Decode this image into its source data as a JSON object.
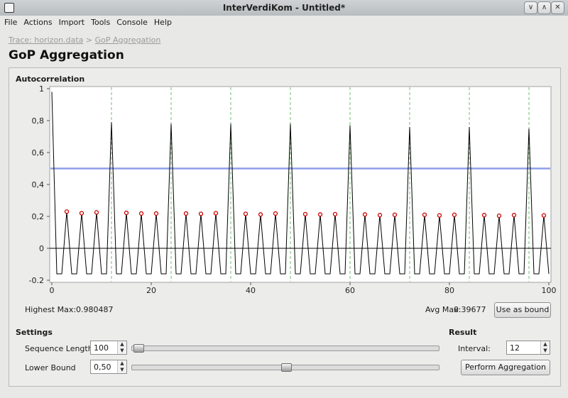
{
  "window": {
    "title": "InterVerdiKom - Untitled*",
    "controls": [
      "∨",
      "∧",
      "✕"
    ]
  },
  "menu": [
    "File",
    "Actions",
    "Import",
    "Tools",
    "Console",
    "Help"
  ],
  "breadcrumb": {
    "root": "Trace: horizon.data",
    "separator": ">",
    "current": "GoP Aggregation"
  },
  "page_title": "GoP Aggregation",
  "autocorrelation": {
    "label": "Autocorrelation",
    "highest_max_label": "Highest Max:",
    "highest_max_value": "0.980487",
    "avg_max_label": "Avg Max:",
    "avg_max_value": "0.39677",
    "use_as_bound_label": "Use as bound"
  },
  "settings": {
    "label": "Settings",
    "sequence_length_label": "Sequence Length",
    "sequence_length_value": "100",
    "sequence_length_slider_fraction": 0.0,
    "lower_bound_label": "Lower Bound",
    "lower_bound_value": "0,50",
    "lower_bound_slider_fraction": 0.5
  },
  "result": {
    "label": "Result",
    "interval_label": "Interval:",
    "interval_value": "12",
    "perform_label": "Perform Aggregation"
  },
  "chart_data": {
    "type": "line",
    "xlim": [
      0,
      100
    ],
    "ylim": [
      -0.2,
      1
    ],
    "x_ticks": [
      "0",
      "20",
      "40",
      "60",
      "80",
      "100"
    ],
    "y_ticks": [
      "-0.2",
      "0",
      "0,2",
      "0,4",
      "0,6",
      "0,8",
      "1"
    ],
    "bound": 0.5,
    "period": 12,
    "major_peaks": [
      {
        "x": 0,
        "y": 0.98
      },
      {
        "x": 12,
        "y": 0.79
      },
      {
        "x": 24,
        "y": 0.78
      },
      {
        "x": 36,
        "y": 0.78
      },
      {
        "x": 48,
        "y": 0.78
      },
      {
        "x": 60,
        "y": 0.77
      },
      {
        "x": 72,
        "y": 0.76
      },
      {
        "x": 84,
        "y": 0.76
      },
      {
        "x": 96,
        "y": 0.75
      }
    ],
    "minor_peaks": [
      {
        "x": 3,
        "y": 0.23
      },
      {
        "x": 6,
        "y": 0.22
      },
      {
        "x": 9,
        "y": 0.225
      },
      {
        "x": 15,
        "y": 0.222
      },
      {
        "x": 18,
        "y": 0.218
      },
      {
        "x": 21,
        "y": 0.218
      },
      {
        "x": 27,
        "y": 0.218
      },
      {
        "x": 30,
        "y": 0.216
      },
      {
        "x": 33,
        "y": 0.22
      },
      {
        "x": 39,
        "y": 0.216
      },
      {
        "x": 42,
        "y": 0.212
      },
      {
        "x": 45,
        "y": 0.218
      },
      {
        "x": 51,
        "y": 0.214
      },
      {
        "x": 54,
        "y": 0.212
      },
      {
        "x": 57,
        "y": 0.214
      },
      {
        "x": 63,
        "y": 0.212
      },
      {
        "x": 66,
        "y": 0.208
      },
      {
        "x": 69,
        "y": 0.21
      },
      {
        "x": 75,
        "y": 0.21
      },
      {
        "x": 78,
        "y": 0.206
      },
      {
        "x": 81,
        "y": 0.21
      },
      {
        "x": 87,
        "y": 0.208
      },
      {
        "x": 90,
        "y": 0.204
      },
      {
        "x": 93,
        "y": 0.208
      },
      {
        "x": 99,
        "y": 0.206
      }
    ],
    "troughs": -0.16,
    "colors": {
      "line": "#000000",
      "bound": "#8f9ee8",
      "period_lines": "#6fbf6f",
      "markers": "#cc0000"
    }
  }
}
